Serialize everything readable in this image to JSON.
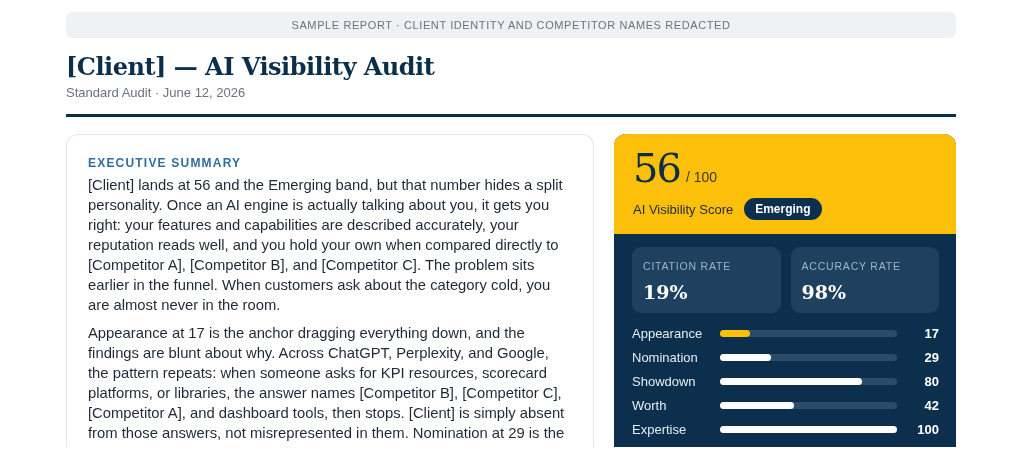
{
  "banner": "SAMPLE REPORT · CLIENT IDENTITY AND COMPETITOR NAMES REDACTED",
  "title": "[Client] — AI Visibility Audit",
  "subtitle": "Standard Audit · June 12, 2026",
  "summary": {
    "heading": "EXECUTIVE SUMMARY",
    "paragraphs": [
      "[Client] lands at 56 and the Emerging band, but that number hides a split personality. Once an AI engine is actually talking about you, it gets you right: your features and capabilities are described accurately, your reputation reads well, and you hold your own when compared directly to [Competitor A], [Competitor B], and [Competitor C]. The problem sits earlier in the funnel. When customers ask about the category cold, you are almost never in the room.",
      "Appearance at 17 is the anchor dragging everything down, and the findings are blunt about why. Across ChatGPT, Perplexity, and Google, the pattern repeats: when someone asks for KPI resources, scorecard platforms, or libraries, the answer names [Competitor B], [Competitor C], [Competitor A], and dashboard tools, then stops. [Client] is simply absent from those answers, not misrepresented in them. Nomination at 29 is the"
    ]
  },
  "score": {
    "value": "56",
    "max": "/ 100",
    "label": "AI Visibility Score",
    "band": "Emerging",
    "rates": [
      {
        "label": "CITATION RATE",
        "value": "19%"
      },
      {
        "label": "ACCURACY RATE",
        "value": "98%"
      }
    ],
    "metrics": [
      {
        "name": "Appearance",
        "level": 0.17,
        "value": "17",
        "weak": true
      },
      {
        "name": "Nomination",
        "level": 0.29,
        "value": "29",
        "weak": false
      },
      {
        "name": "Showdown",
        "level": 0.8,
        "value": "80",
        "weak": false
      },
      {
        "name": "Worth",
        "level": 0.42,
        "value": "42",
        "weak": false
      },
      {
        "name": "Expertise",
        "level": 1,
        "value": "100",
        "weak": false
      }
    ]
  }
}
